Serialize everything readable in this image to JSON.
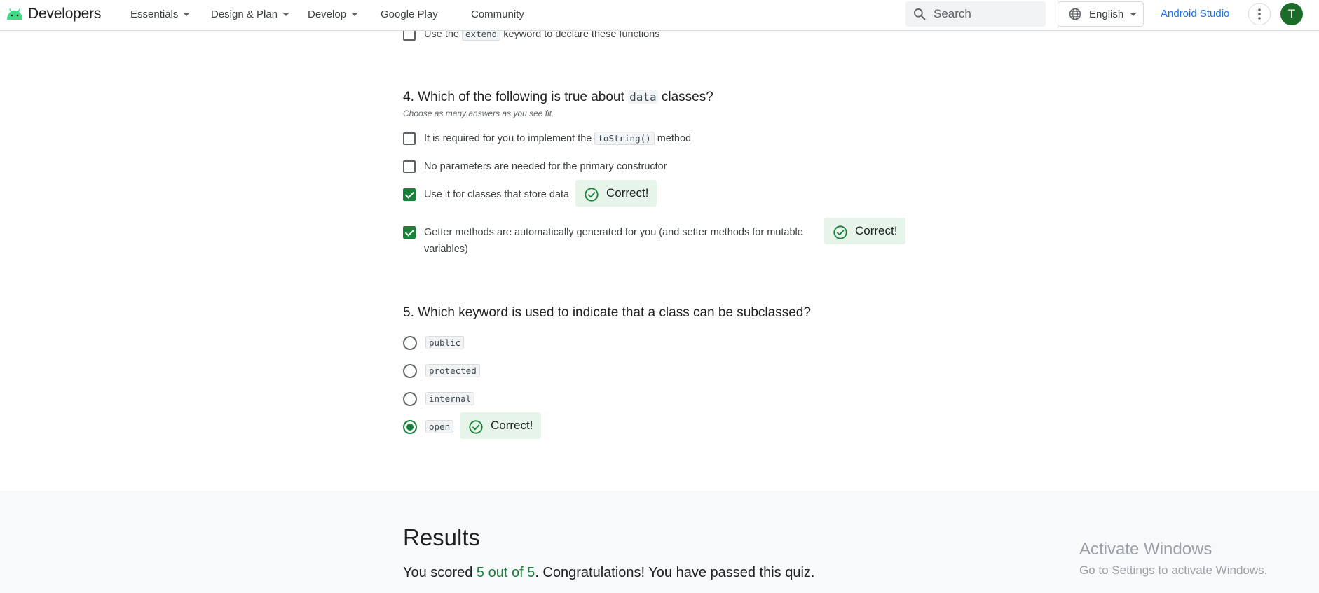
{
  "header": {
    "logo_text": "Developers",
    "nav": [
      "Essentials",
      "Design & Plan",
      "Develop",
      "Google Play",
      "Community"
    ],
    "search_placeholder": "Search",
    "language": "English",
    "android_studio": "Android Studio",
    "avatar_initial": "T"
  },
  "q3_tail": {
    "pre": "Use the",
    "code": "extend",
    "post": "keyword to declare these functions"
  },
  "q4": {
    "title_pre": "4. Which of the following is true about",
    "title_code": "data",
    "title_post": "classes?",
    "hint": "Choose as many answers as you see fit.",
    "options": [
      {
        "pre": "It is required for you to implement the",
        "code": "toString()",
        "post": "method",
        "checked": false
      },
      {
        "text": "No parameters are needed for the primary constructor",
        "checked": false
      },
      {
        "text": "Use it for classes that store data",
        "checked": true
      },
      {
        "line1": "Getter methods are automatically generated for you (and setter methods for mutable",
        "line2": "variables)",
        "checked": true
      }
    ]
  },
  "q5": {
    "title": "5. Which keyword is used to indicate that a class can be subclassed?",
    "options": [
      {
        "code": "public",
        "selected": false
      },
      {
        "code": "protected",
        "selected": false
      },
      {
        "code": "internal",
        "selected": false
      },
      {
        "code": "open",
        "selected": true
      }
    ]
  },
  "feedback": {
    "correct": "Correct!"
  },
  "results": {
    "title": "Results",
    "score_pre": "You scored",
    "score_value": "5 out of 5",
    "score_post": ". Congratulations! You have passed this quiz."
  },
  "watermark": {
    "line1": "Activate Windows",
    "line2": "Go to Settings to activate Windows."
  },
  "colors": {
    "accent": "#188038",
    "link": "#1a73e8",
    "correct_bg": "#e6f4ea"
  }
}
